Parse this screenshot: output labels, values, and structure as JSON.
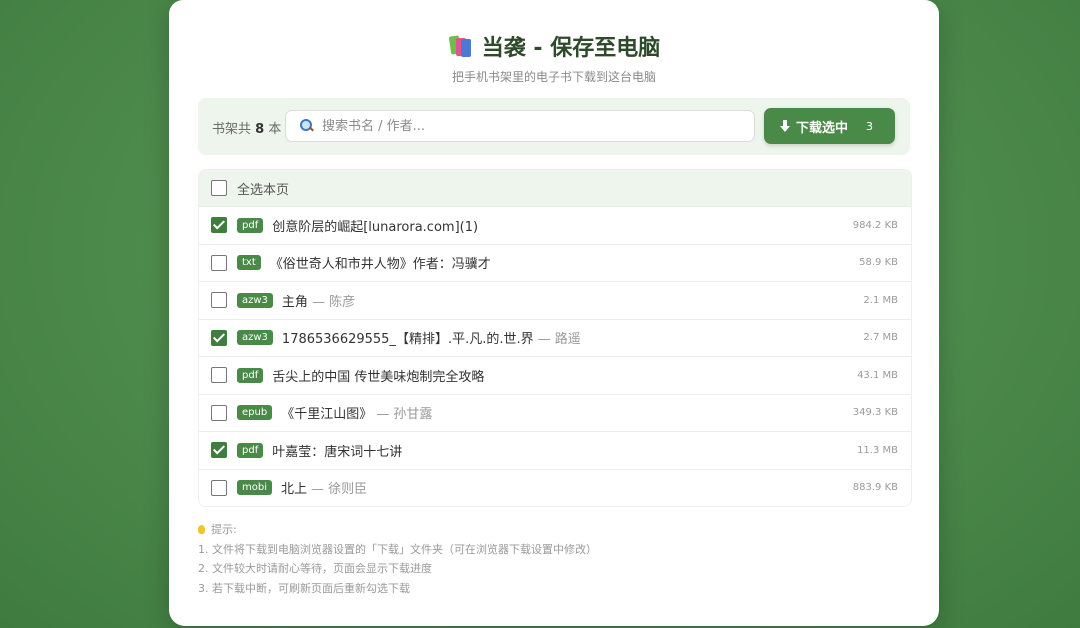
{
  "header": {
    "icon": "books-icon",
    "title": "当袭 - 保存至电脑",
    "subtitle": "把手机书架里的电子书下载到这台电脑"
  },
  "toolbar": {
    "count_prefix": "书架共",
    "count": "8",
    "count_suffix": "本",
    "search_placeholder": "搜索书名 / 作者...",
    "download_label": "下载选中",
    "selected_count": "3"
  },
  "list": {
    "select_all_label": "全选本页",
    "select_all_checked": false,
    "rows": [
      {
        "checked": true,
        "format": "pdf",
        "title": "创意阶层的崛起[lunarora.com](1)",
        "author": "",
        "size": "984.2 KB"
      },
      {
        "checked": false,
        "format": "txt",
        "title": "《俗世奇人和市井人物》作者：冯骥才",
        "author": "",
        "size": "58.9 KB"
      },
      {
        "checked": false,
        "format": "azw3",
        "title": "主角",
        "author": "— 陈彦",
        "size": "2.1 MB"
      },
      {
        "checked": true,
        "format": "azw3",
        "title": "1786536629555_【精排】.平.凡.的.世.界",
        "author": "— 路遥",
        "size": "2.7 MB"
      },
      {
        "checked": false,
        "format": "pdf",
        "title": "舌尖上的中国 传世美味炮制完全攻略",
        "author": "",
        "size": "43.1 MB"
      },
      {
        "checked": false,
        "format": "epub",
        "title": "《千里江山图》",
        "author": "— 孙甘露",
        "size": "349.3 KB"
      },
      {
        "checked": true,
        "format": "pdf",
        "title": "叶嘉莹：唐宋词十七讲",
        "author": "",
        "size": "11.3 MB"
      },
      {
        "checked": false,
        "format": "mobi",
        "title": "北上",
        "author": "— 徐则臣",
        "size": "883.9 KB"
      }
    ]
  },
  "tips": {
    "title": "提示:",
    "items": [
      "1. 文件将下载到电脑浏览器设置的「下载」文件夹（可在浏览器下载设置中修改）",
      "2. 文件较大时请耐心等待，页面会显示下载进度",
      "3. 若下载中断，可刷新页面后重新勾选下载"
    ]
  },
  "colors": {
    "background": "#4c8a4b",
    "accent": "#4a8a48",
    "title_text": "#2e4a2b"
  }
}
